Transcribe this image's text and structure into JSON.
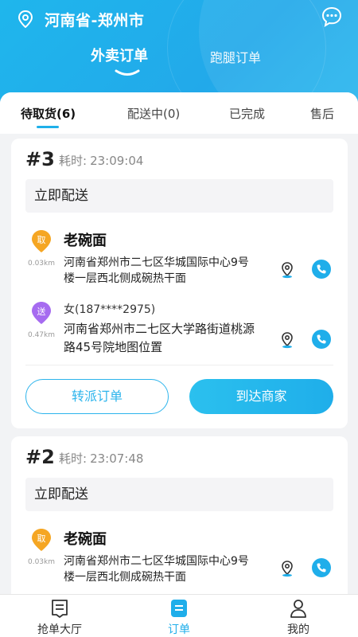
{
  "header": {
    "city": "河南省-郑州市",
    "tabs": [
      {
        "label": "外卖订单",
        "active": true
      },
      {
        "label": "跑腿订单",
        "active": false
      }
    ],
    "accent": "#22a9ea"
  },
  "status_tabs": [
    {
      "label": "待取货(6)",
      "active": true
    },
    {
      "label": "配送中(0)",
      "active": false
    },
    {
      "label": "已完成",
      "active": false
    },
    {
      "label": "售后",
      "active": false
    }
  ],
  "orders": [
    {
      "number": "#3",
      "time_label": "耗时:",
      "time_value": "23:09:04",
      "dispatch": "立即配送",
      "pickup": {
        "badge": "取",
        "distance": "0.03km",
        "name": "老碗面",
        "address": "河南省郑州市二七区华城国际中心9号楼一层西北侧成碗热干面"
      },
      "delivery": {
        "badge": "送",
        "distance": "0.47km",
        "contact": "女(187****2975)",
        "address": "河南省郑州市二七区大学路街道桃源路45号院地图位置"
      },
      "btn_transfer": "转派订单",
      "btn_arrive": "到达商家"
    },
    {
      "number": "#2",
      "time_label": "耗时:",
      "time_value": "23:07:48",
      "dispatch": "立即配送",
      "pickup": {
        "badge": "取",
        "distance": "0.03km",
        "name": "老碗面",
        "address": "河南省郑州市二七区华城国际中心9号楼一层西北侧成碗热干面"
      }
    }
  ],
  "bottom_nav": [
    {
      "label": "抢单大厅",
      "icon": "order-hall-icon",
      "active": false
    },
    {
      "label": "订单",
      "icon": "orders-icon",
      "active": true
    },
    {
      "label": "我的",
      "icon": "profile-icon",
      "active": false
    }
  ],
  "colors": {
    "pickup_badge": "#f5a623",
    "delivery_badge": "#a66bf0",
    "call": "#1faeea"
  }
}
